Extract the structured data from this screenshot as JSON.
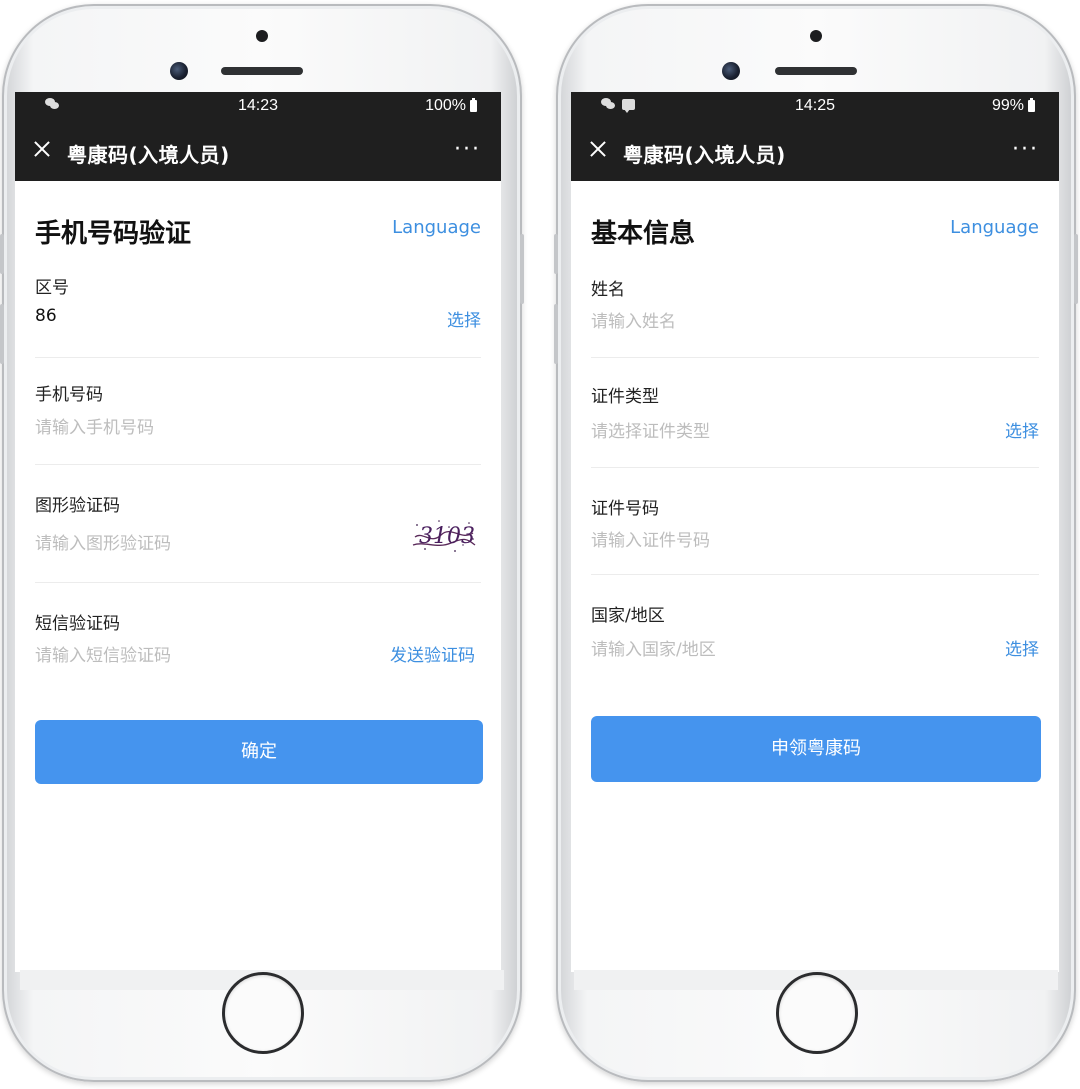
{
  "phone_left": {
    "status": {
      "time": "14:23",
      "battery": "100%"
    },
    "titlebar": {
      "title": "粤康码(入境人员)",
      "more": "···"
    },
    "page_title": "手机号码验证",
    "language_link": "Language",
    "fields": {
      "area_code": {
        "label": "区号",
        "value": "86",
        "action": "选择"
      },
      "phone": {
        "label": "手机号码",
        "placeholder": "请输入手机号码"
      },
      "captcha": {
        "label": "图形验证码",
        "placeholder": "请输入图形验证码",
        "captcha_text": "3103"
      },
      "sms": {
        "label": "短信验证码",
        "placeholder": "请输入短信验证码",
        "action": "发送验证码"
      }
    },
    "submit_label": "确定"
  },
  "phone_right": {
    "status": {
      "time": "14:25",
      "battery": "99%"
    },
    "titlebar": {
      "title": "粤康码(入境人员)",
      "more": "···"
    },
    "page_title": "基本信息",
    "language_link": "Language",
    "fields": {
      "name": {
        "label": "姓名",
        "placeholder": "请输入姓名"
      },
      "id_type": {
        "label": "证件类型",
        "placeholder": "请选择证件类型",
        "action": "选择"
      },
      "id_number": {
        "label": "证件号码",
        "placeholder": "请输入证件号码"
      },
      "country": {
        "label": "国家/地区",
        "placeholder": "请输入国家/地区",
        "action": "选择"
      }
    },
    "submit_label": "申领粤康码"
  }
}
